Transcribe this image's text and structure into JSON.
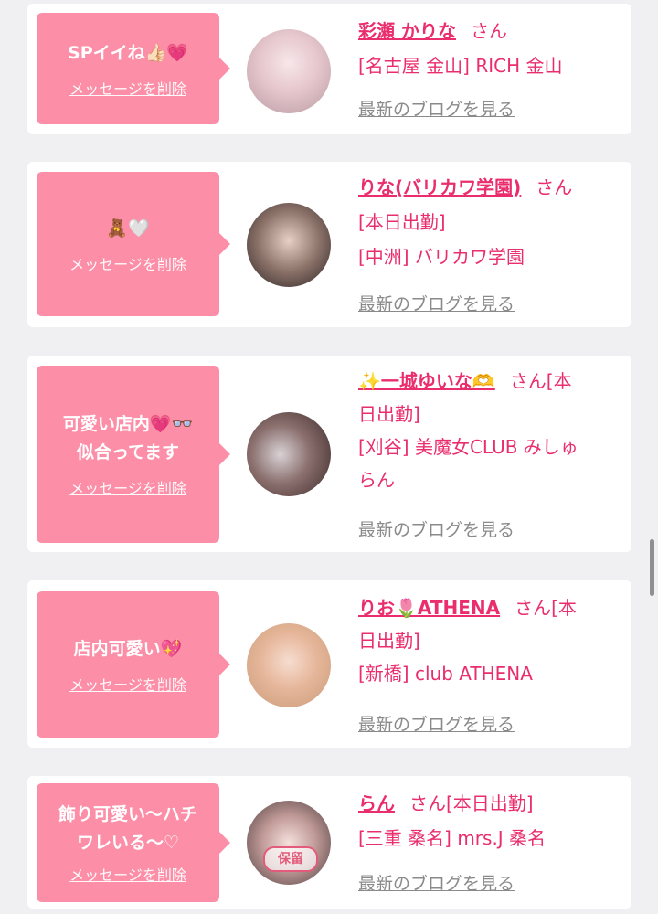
{
  "colors": {
    "bubble": "#fc8ea7",
    "accent": "#ea2d6c",
    "muted": "#8a8a8a"
  },
  "delete_label": "メッセージを削除",
  "blog_label": "最新のブログを見る",
  "cards": [
    {
      "message": [
        "SPイイね👍🏻💗"
      ],
      "name": "彩瀬 かりな",
      "honorific": "さん",
      "details": [
        "[名古屋 金山] RICH 金山"
      ]
    },
    {
      "message": [
        "🧸🤍"
      ],
      "name": "りな(バリカワ学園)",
      "honorific": "さん",
      "details": [
        "[本日出勤]",
        "[中洲] バリカワ学園"
      ]
    },
    {
      "message": [
        "可愛い店内💗👓",
        "似合ってます"
      ],
      "name": "✨一城ゆいな🫶",
      "honorific": "さん[本",
      "details": [
        "日出勤]",
        "[刈谷] 美魔女CLUB みしゅ",
        "らん"
      ]
    },
    {
      "message": [
        "店内可愛い💖"
      ],
      "name": "りお🌷ATHENA",
      "honorific": "さん[本",
      "details": [
        "日出勤]",
        "[新橋] club ATHENA"
      ]
    },
    {
      "message": [
        "飾り可愛い〜ハチ",
        "ワレいる〜♡"
      ],
      "name": "らん",
      "honorific": "さん[本日出勤]",
      "details": [
        "[三重 桑名] mrs.J 桑名"
      ],
      "avatar_stamp": "保留"
    }
  ]
}
